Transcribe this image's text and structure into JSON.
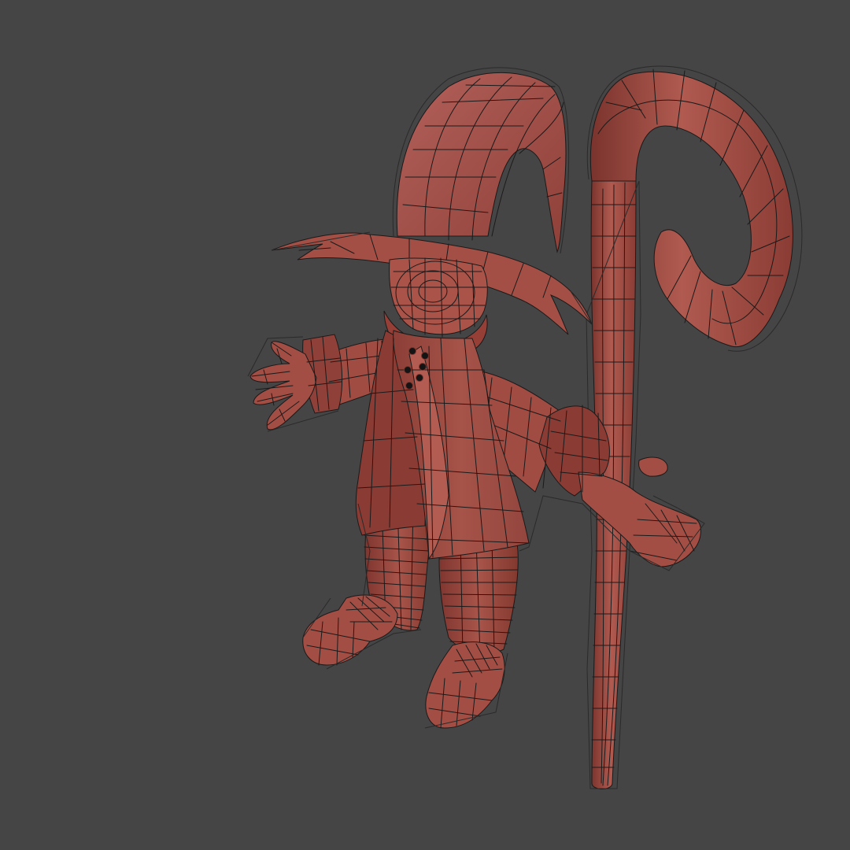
{
  "viewport": {
    "background_color": "#454545",
    "mesh_color": "#a24e44",
    "mesh_highlight_color": "#b8645a",
    "mesh_shadow_color": "#7a342d",
    "wire_color": "#1a1a1a",
    "cage_color": "#2a2a2a",
    "button_color": "#141414"
  },
  "model": {
    "icon": "wizard-character-mesh-icon",
    "parts": [
      "hat",
      "brim",
      "head",
      "scarf",
      "coat",
      "left-arm",
      "right-arm",
      "left-hand",
      "right-hand",
      "legs",
      "left-boot",
      "right-boot",
      "staff"
    ],
    "coat_buttons": 6
  }
}
